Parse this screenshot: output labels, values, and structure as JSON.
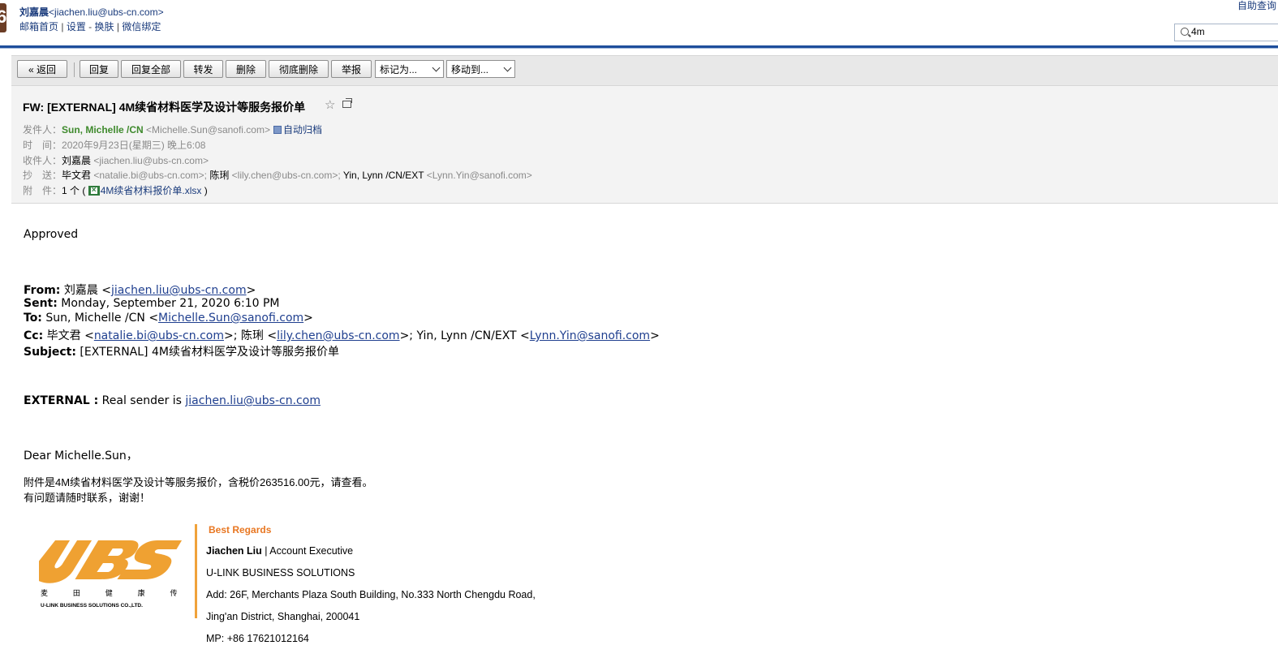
{
  "header": {
    "user_name": "刘嘉晨",
    "user_email": "<jiachen.liu@ubs-cn.com>",
    "links": [
      "邮箱首页",
      "设置",
      "换肤",
      "微信绑定"
    ],
    "self_help": "自助查询",
    "search_value": "4m"
  },
  "toolbar": {
    "back": "« 返回",
    "reply": "回复",
    "reply_all": "回复全部",
    "forward": "转发",
    "delete": "删除",
    "perm_delete": "彻底删除",
    "report": "举报",
    "mark_as": "标记为...",
    "move_to": "移动到..."
  },
  "mail": {
    "subject": "FW: [EXTERNAL] 4M续省材料医学及设计等服务报价单",
    "from_label": "发件人：",
    "from_name": "Sun, Michelle /CN",
    "from_email": "<Michelle.Sun@sanofi.com>",
    "auto_archive": "自动归档",
    "time_label": "时　间：",
    "time": "2020年9月23日(星期三) 晚上6:08",
    "to_label": "收件人：",
    "to_name": "刘嘉晨",
    "to_email": "<jiachen.liu@ubs-cn.com>",
    "cc_label": "抄　送：",
    "cc": [
      {
        "name": "毕文君",
        "email": "<natalie.bi@ubs-cn.com>;"
      },
      {
        "name": "陈琍",
        "email": "<lily.chen@ubs-cn.com>;"
      },
      {
        "name": "Yin, Lynn /CN/EXT",
        "email": "<Lynn.Yin@sanofi.com>"
      }
    ],
    "attach_label": "附　件：",
    "attach_count": "1 个 (",
    "attach_name": "4M续省材料报价单.xlsx",
    "attach_close": ")"
  },
  "body": {
    "approved": "Approved",
    "fw_from_label": "From:",
    "fw_from_name": " 刘嘉晨 <",
    "fw_from_email": "jiachen.liu@ubs-cn.com",
    "fw_sent_label": "Sent:",
    "fw_sent": " Monday, September 21, 2020 6:10 PM",
    "fw_to_label": "To:",
    "fw_to_name": " Sun, Michelle /CN <",
    "fw_to_email": "Michelle.Sun@sanofi.com",
    "fw_cc_label": "Cc:",
    "fw_cc_1": " 毕文君 <",
    "fw_cc_1_email": "natalie.bi@ubs-cn.com",
    "fw_cc_2": ">; 陈琍 <",
    "fw_cc_2_email": "lily.chen@ubs-cn.com",
    "fw_cc_3": ">; Yin, Lynn /CN/EXT <",
    "fw_cc_3_email": "Lynn.Yin@sanofi.com",
    "fw_subject_label": "Subject:",
    "fw_subject": " [EXTERNAL] 4M续省材料医学及设计等服务报价单",
    "external_label": "EXTERNAL :",
    "external_text": " Real sender is ",
    "external_email": "jiachen.liu@ubs-cn.com",
    "greeting": "Dear Michelle.Sun，",
    "line1": "附件是4M续省材料医学及设计等服务报价，含税价263516.00元，请查看。",
    "line2": "有问题请随时联系，谢谢！"
  },
  "signature": {
    "regards": "Best Regards",
    "name": "Jiachen Liu",
    "title": " | Account Executive",
    "company": "U-LINK BUSINESS SOLUTIONS",
    "address1": "Add: 26F, Merchants Plaza South Building, No.333 North Chengdu Road,",
    "address2": "Jing'an District, Shanghai, 200041",
    "mobile": "MP: +86 17621012164",
    "logo_text": "UBS",
    "logo_cn": "麦 田 健 康 传 播",
    "logo_en": "U-LINK BUSINESS SOLUTIONS CO.,LTD."
  },
  "colors": {
    "header_rule": "#1e4e9b",
    "sender_green": "#3f8a2d",
    "link_blue": "#1f3f8f",
    "brand_orange": "#f0a23a"
  }
}
